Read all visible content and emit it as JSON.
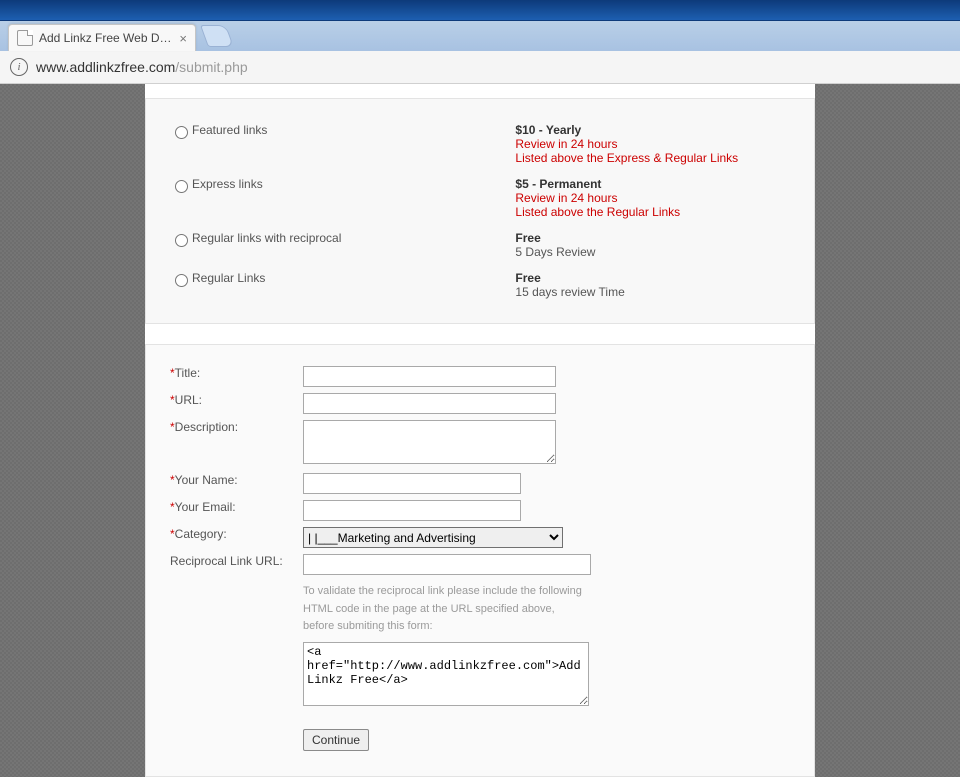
{
  "browser": {
    "tab_title": "Add Linkz Free Web Direc",
    "url_host": "www.addlinkzfree.com",
    "url_path": "/submit.php"
  },
  "options": [
    {
      "label": "Featured links",
      "price": "$10 - Yearly",
      "line1": "Review in 24 hours",
      "line2": "Listed above the Express & Regular Links",
      "line1_red": true,
      "line2_red": true
    },
    {
      "label": "Express links",
      "price": "$5 - Permanent",
      "line1": "Review in 24 hours",
      "line2": "Listed above the Regular Links",
      "line1_red": true,
      "line2_red": true
    },
    {
      "label": "Regular links with reciprocal",
      "price": "Free",
      "line1": "5 Days Review",
      "line2": "",
      "line1_red": false,
      "line2_red": false
    },
    {
      "label": "Regular Links",
      "price": "Free",
      "line1": "15 days review Time",
      "line2": "",
      "line1_red": false,
      "line2_red": false
    }
  ],
  "form": {
    "labels": {
      "title": "Title:",
      "url": "URL:",
      "description": "Description:",
      "name": "Your Name:",
      "email": "Your Email:",
      "category": "Category:",
      "reciprocal": "Reciprocal Link URL:"
    },
    "values": {
      "title": "",
      "url": "",
      "description": "",
      "name": "",
      "email": "",
      "reciprocal": "",
      "code": "<a href=\"http://www.addlinkzfree.com\">Add Linkz Free</a>"
    },
    "category_selected": "|   |___Marketing and Advertising",
    "hint": "To validate the reciprocal link please include the following HTML code in the page at the URL specified above, before submiting this form:",
    "continue": "Continue"
  }
}
